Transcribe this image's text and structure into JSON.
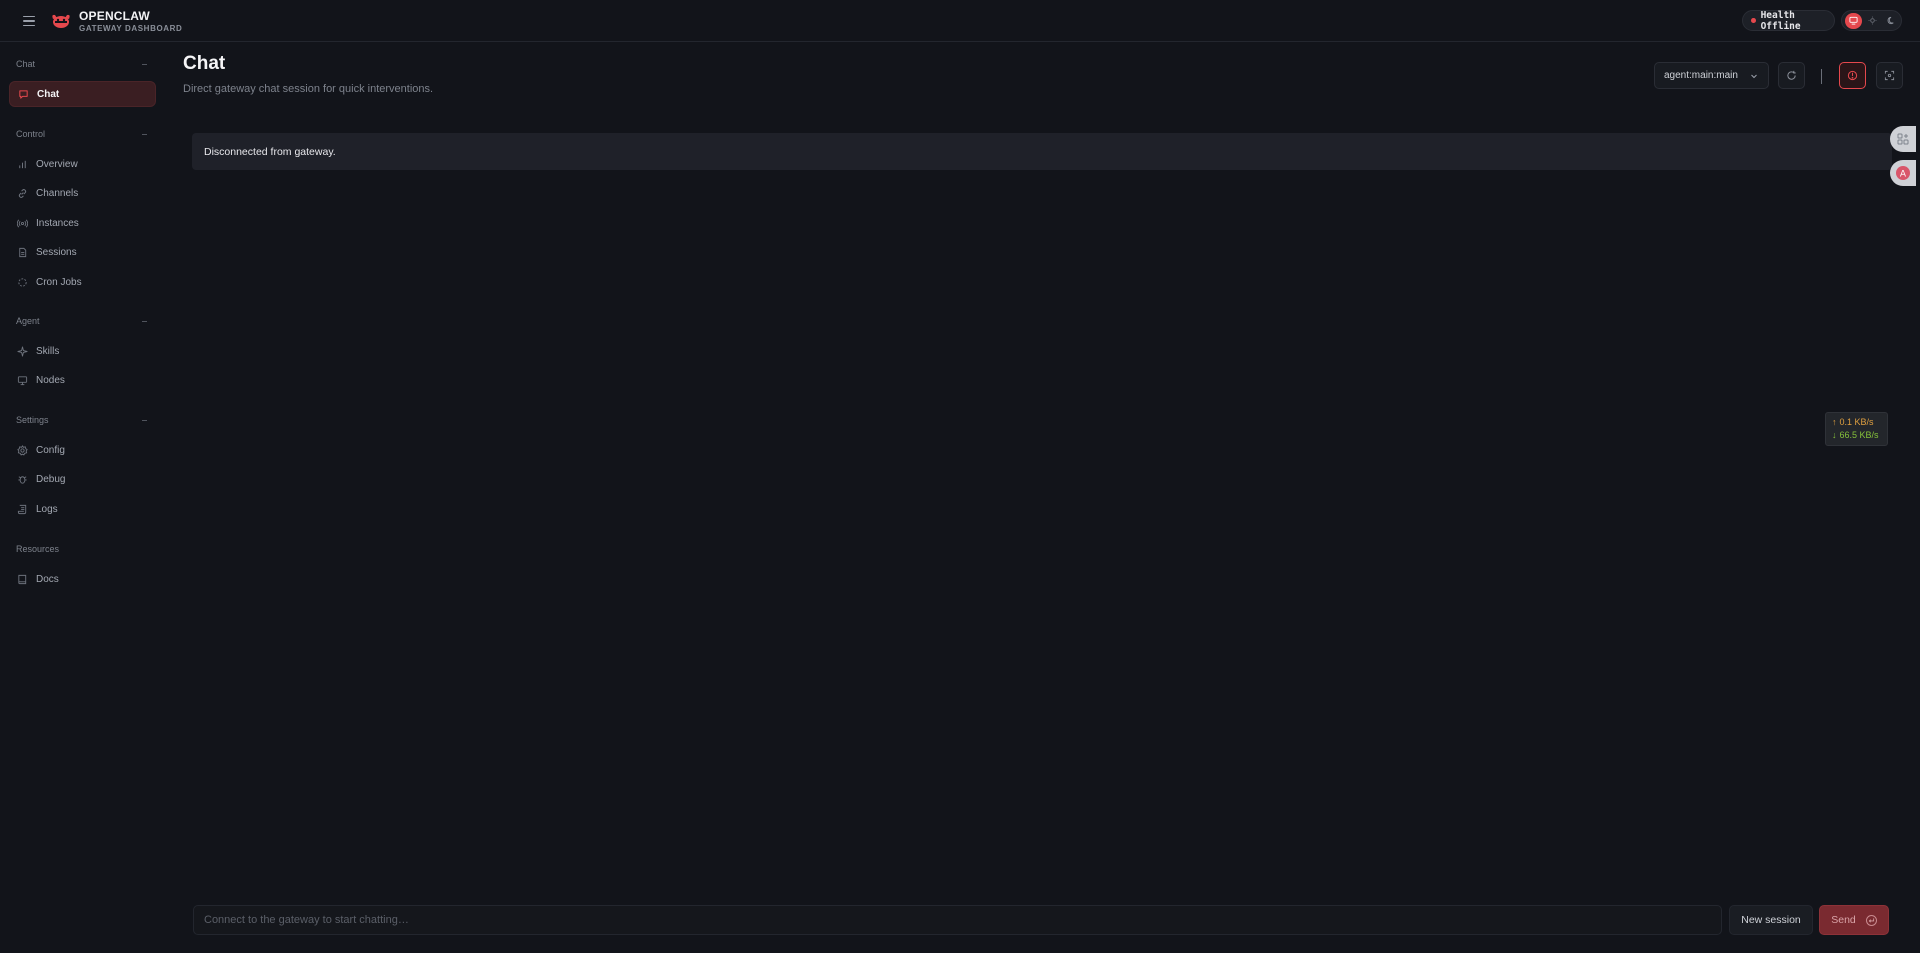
{
  "brand": {
    "title": "OPENCLAW",
    "subtitle": "GATEWAY DASHBOARD"
  },
  "header": {
    "health_label": "Health Offline",
    "health_color": "#e5484d",
    "theme_modes": [
      "system-icon",
      "sun-icon",
      "moon-icon"
    ],
    "active_theme": "system"
  },
  "sidebar": {
    "groups": [
      {
        "label": "Chat",
        "items": [
          {
            "label": "Chat",
            "icon": "chat-bubble-icon",
            "active": true
          }
        ]
      },
      {
        "label": "Control",
        "items": [
          {
            "label": "Overview",
            "icon": "bar-chart-icon"
          },
          {
            "label": "Channels",
            "icon": "link-icon"
          },
          {
            "label": "Instances",
            "icon": "radio-signal-icon"
          },
          {
            "label": "Sessions",
            "icon": "document-icon"
          },
          {
            "label": "Cron Jobs",
            "icon": "loader-icon"
          }
        ]
      },
      {
        "label": "Agent",
        "items": [
          {
            "label": "Skills",
            "icon": "sparkle-icon"
          },
          {
            "label": "Nodes",
            "icon": "monitor-icon"
          }
        ]
      },
      {
        "label": "Settings",
        "items": [
          {
            "label": "Config",
            "icon": "gear-icon"
          },
          {
            "label": "Debug",
            "icon": "bug-icon"
          },
          {
            "label": "Logs",
            "icon": "scroll-icon"
          }
        ]
      },
      {
        "label": "Resources",
        "items": [
          {
            "label": "Docs",
            "icon": "book-icon"
          }
        ]
      }
    ]
  },
  "main": {
    "title": "Chat",
    "subtitle": "Direct gateway chat session for quick interventions.",
    "session_select": "agent:main:main",
    "banner": "Disconnected from gateway."
  },
  "net_monitor": {
    "upload": "0.1 KB/s",
    "download": "66.5 KB/s"
  },
  "composer": {
    "placeholder": "Connect to the gateway to start chatting…",
    "new_session_label": "New session",
    "send_label": "Send"
  },
  "colors": {
    "accent": "#e5484d",
    "background": "#12141a"
  }
}
